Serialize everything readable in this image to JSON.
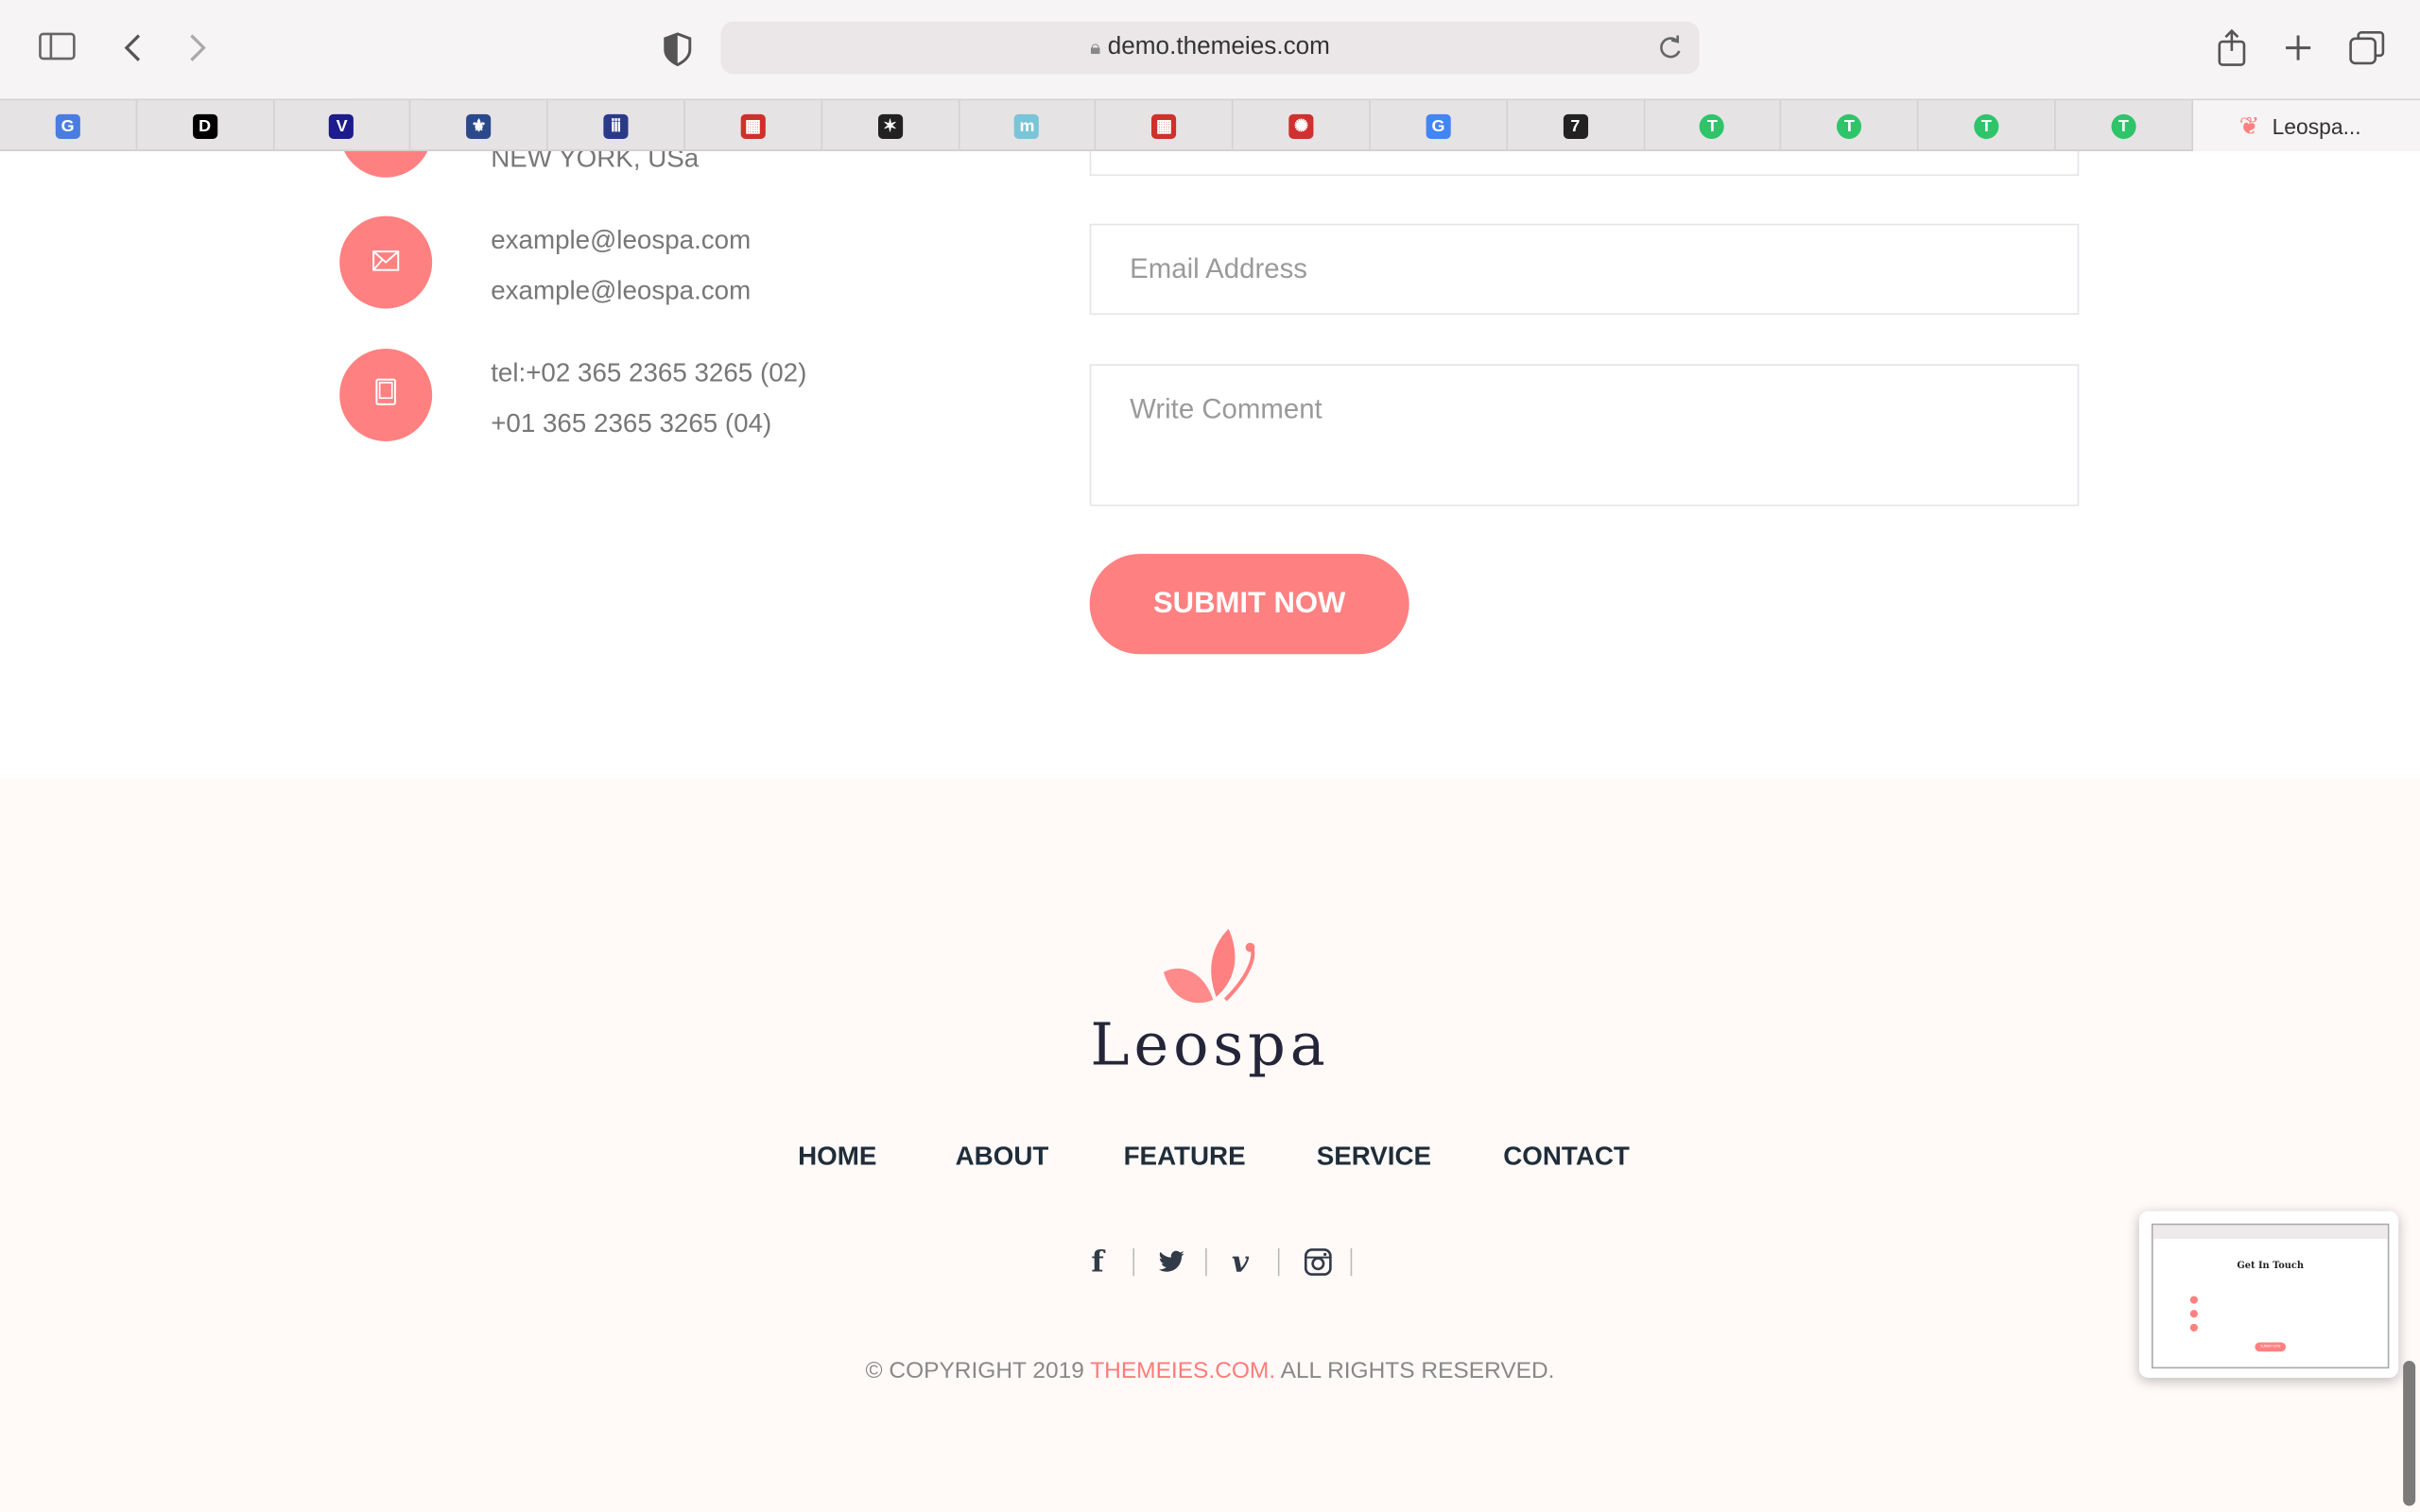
{
  "browser": {
    "url": "demo.themeies.com",
    "bookmarks": [
      {
        "icon": "google-translate-icon",
        "glyph": "G",
        "color": "#4a7de0"
      },
      {
        "icon": "d-logo-icon",
        "glyph": "D",
        "color": "#000000"
      },
      {
        "icon": "v-logo-icon",
        "glyph": "V",
        "color": "#1c1c8c"
      },
      {
        "icon": "fleur-icon",
        "glyph": "⚜",
        "color": "#2a4a8a"
      },
      {
        "icon": "columns-icon",
        "glyph": "ⅲ",
        "color": "#2a3a8a"
      },
      {
        "icon": "grid-flag-icon",
        "glyph": "▦",
        "color": "#d0302a"
      },
      {
        "icon": "eagle-icon",
        "glyph": "✶",
        "color": "#222222"
      },
      {
        "icon": "make-on-icon",
        "glyph": "m",
        "color": "#7ac4d8"
      },
      {
        "icon": "grid-flag-icon",
        "glyph": "▦",
        "color": "#d0302a"
      },
      {
        "icon": "seal-icon",
        "glyph": "✺",
        "color": "#d03030"
      },
      {
        "icon": "google-icon",
        "glyph": "G",
        "color": "#4285f4"
      },
      {
        "icon": "seventy-seven-icon",
        "glyph": "7",
        "color": "#222222"
      },
      {
        "icon": "t-green-icon",
        "glyph": "T",
        "color": "#2fc46a"
      },
      {
        "icon": "t-green-icon",
        "glyph": "T",
        "color": "#2fc46a"
      },
      {
        "icon": "t-green-icon",
        "glyph": "T",
        "color": "#2fc46a"
      },
      {
        "icon": "t-green-icon",
        "glyph": "T",
        "color": "#2fc46a"
      }
    ],
    "active_tab": "Leospa..."
  },
  "contact": {
    "address_line2": "NEW YORK, USa",
    "emails": [
      "example@leospa.com",
      "example@leospa.com"
    ],
    "phones": [
      "tel:+02 365 2365 3265 (02)",
      "+01 365 2365 3265 (04)"
    ],
    "email_placeholder": "Email Address",
    "comment_placeholder": "Write Comment",
    "submit_label": "SUBMIT NOW"
  },
  "footer": {
    "logo": "Leospa",
    "nav": [
      "HOME",
      "ABOUT",
      "FEATURE",
      "SERVICE",
      "CONTACT"
    ],
    "social": [
      "facebook",
      "twitter",
      "vimeo",
      "instagram"
    ],
    "copyright_prefix": "© COPYRIGHT 2019 ",
    "copyright_link": "THEMEIES.COM.",
    "copyright_suffix": " ALL RIGHTS RESERVED."
  },
  "thumbnail": {
    "title": "Get In Touch",
    "button": "SUBMIT NOW"
  },
  "colors": {
    "accent": "#ff8080",
    "footer_bg": "#fffaf8",
    "nav_text": "#1f2d3a"
  }
}
